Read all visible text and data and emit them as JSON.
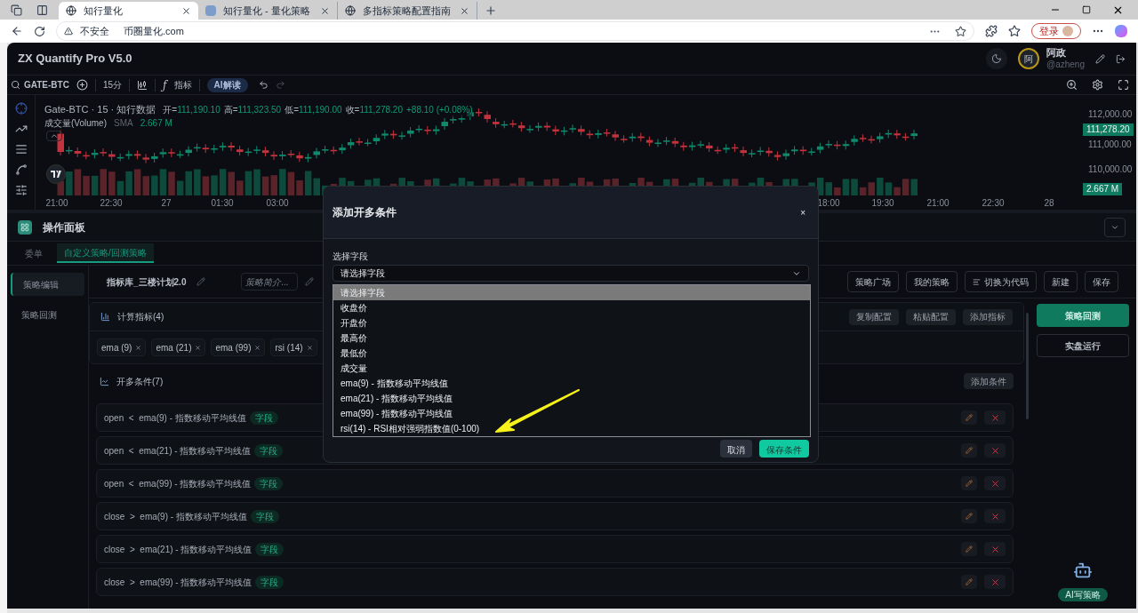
{
  "browser": {
    "tabs": [
      {
        "title": "知行量化",
        "selected": true
      },
      {
        "title": "知行量化 - 量化策略",
        "selected": false
      },
      {
        "title": "多指标策略配置指南",
        "selected": false
      }
    ],
    "security": "不安全",
    "url": "币圈量化.com",
    "login": "登录"
  },
  "app": {
    "title": "ZX Quantify Pro V5.0",
    "user": {
      "avatar": "阿",
      "name": "阿政",
      "handle": "@azheng"
    }
  },
  "toolbar": {
    "symbol": "GATE-BTC",
    "interval": "15分",
    "function_glyph": "ƒ",
    "indicators": "指标",
    "ai": "AI解读"
  },
  "chart": {
    "title": "Gate-BTC · 15 · 知行数据",
    "ohlc": [
      {
        "label": "开=",
        "value": "111,190.10"
      },
      {
        "label": "高=",
        "value": "111,323.50"
      },
      {
        "label": "低=",
        "value": "111,190.00"
      },
      {
        "label": "收=",
        "value": "111,278.20"
      }
    ],
    "change": "+88.10 (+0.08%)",
    "volume_label": "成交量(Volume)",
    "volume_ma": "SMA",
    "volume_value": "2.667 M",
    "price_ticks": [
      "112,000.00",
      "111,000.00",
      "110,000.00"
    ],
    "last_price": "111,278.20",
    "volume_tag": "2.667 M",
    "time_ticks": [
      "21:00",
      "22:30",
      "27",
      "01:30",
      "03:00",
      "18:00",
      "19:30",
      "21:00",
      "22:30",
      "28"
    ]
  },
  "panel": {
    "title": "操作面板",
    "tabs": [
      {
        "label": "委单",
        "selected": false
      },
      {
        "label": "自定义策略/回测策略",
        "selected": true
      }
    ],
    "nav": [
      {
        "label": "策略编辑",
        "selected": true
      },
      {
        "label": "策略回测",
        "selected": false
      }
    ],
    "strategy": {
      "name": "指标库_三楼计划2.0",
      "description_placeholder": "策略简介...",
      "actions": [
        "策略广场",
        "我的策略",
        "切换为代码",
        "新建",
        "保存"
      ]
    },
    "indicators": {
      "title": "计算指标(4)",
      "actions": [
        "复制配置",
        "粘贴配置",
        "添加指标"
      ],
      "chips": [
        "ema (9)",
        "ema (21)",
        "ema (99)",
        "rsi (14)"
      ]
    },
    "long_conditions": {
      "title": "开多条件(7)",
      "add": "添加条件",
      "rows": [
        {
          "field": "open",
          "op": "<",
          "target": "ema(9) - 指数移动平均线值",
          "tag": "字段"
        },
        {
          "field": "open",
          "op": "<",
          "target": "ema(21) - 指数移动平均线值",
          "tag": "字段"
        },
        {
          "field": "open",
          "op": "<",
          "target": "ema(99) - 指数移动平均线值",
          "tag": "字段"
        },
        {
          "field": "close",
          "op": ">",
          "target": "ema(9) - 指数移动平均线值",
          "tag": "字段"
        },
        {
          "field": "close",
          "op": ">",
          "target": "ema(21) - 指数移动平均线值",
          "tag": "字段"
        },
        {
          "field": "close",
          "op": ">",
          "target": "ema(99) - 指数移动平均线值",
          "tag": "字段"
        }
      ]
    },
    "side": {
      "backtest": "策略回测",
      "live": "实盘运行",
      "ai_badge": "AI写策略"
    }
  },
  "modal": {
    "title": "添加开多条件",
    "close": "×",
    "field_label": "选择字段",
    "select_value": "请选择字段",
    "options": [
      {
        "label": "请选择字段",
        "selected": true
      },
      {
        "label": "收盘价",
        "selected": false
      },
      {
        "label": "开盘价",
        "selected": false
      },
      {
        "label": "最高价",
        "selected": false
      },
      {
        "label": "最低价",
        "selected": false
      },
      {
        "label": "成交量",
        "selected": false
      },
      {
        "label": "ema(9) - 指数移动平均线值",
        "selected": false
      },
      {
        "label": "ema(21) - 指数移动平均线值",
        "selected": false
      },
      {
        "label": "ema(99) - 指数移动平均线值",
        "selected": false
      },
      {
        "label": "rsi(14) - RSI相对强弱指数值(0-100)",
        "selected": false
      }
    ],
    "buttons": [
      "取消",
      "保存条件"
    ]
  }
}
